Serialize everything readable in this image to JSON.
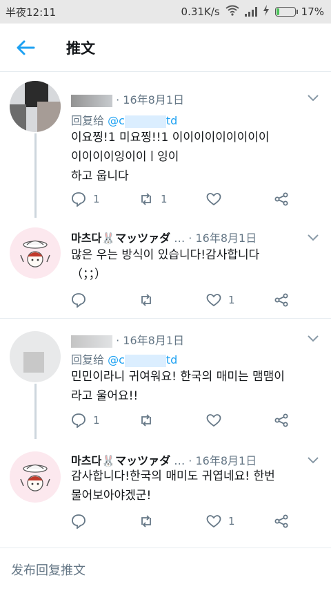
{
  "status_bar": {
    "time": "半夜12:11",
    "speed": "0.31K/s",
    "battery": "17%",
    "battery_level": 0.17,
    "battery_color": "#4cc25a"
  },
  "app_bar": {
    "title": "推文"
  },
  "accent_color": "#1da1f2",
  "tweets": [
    {
      "date": "16年8月1日",
      "reply_label": "回复给",
      "reply_handle_prefix": "@c",
      "reply_handle_suffix": "td",
      "lines": [
        "이요찡!1 미요찡!!1 이이이이이이이이이",
        "이이이이잉이이ㅣ잉이",
        "하고 웁니다"
      ],
      "reply_count": "1",
      "retweet_count": "1",
      "like_count": ""
    },
    {
      "name": "마츠다🐰マッツァダ",
      "ellipsis": "…",
      "date": "16年8月1日",
      "lines": [
        "많은 우는 방식이 있습니다!감사합니다",
        "（；；）"
      ],
      "reply_count": "",
      "retweet_count": "",
      "like_count": "1"
    },
    {
      "date": "16年8月1日",
      "reply_label": "回复给",
      "reply_handle_prefix": "@c",
      "reply_handle_suffix": "td",
      "lines": [
        "민민이라니 귀여워요! 한국의 매미는 맴맴이",
        "라고 울어요!!"
      ],
      "reply_count": "1",
      "retweet_count": "",
      "like_count": ""
    },
    {
      "name": "마츠다🐰マッツァダ",
      "ellipsis": "…",
      "date": "16年8月1日",
      "lines": [
        "감사합니다!한국의 매미도 귀엽네요! 한번",
        "물어보아야겠군!"
      ],
      "reply_count": "",
      "retweet_count": "",
      "like_count": "1"
    }
  ],
  "composer": {
    "placeholder": "发布回复推文"
  }
}
